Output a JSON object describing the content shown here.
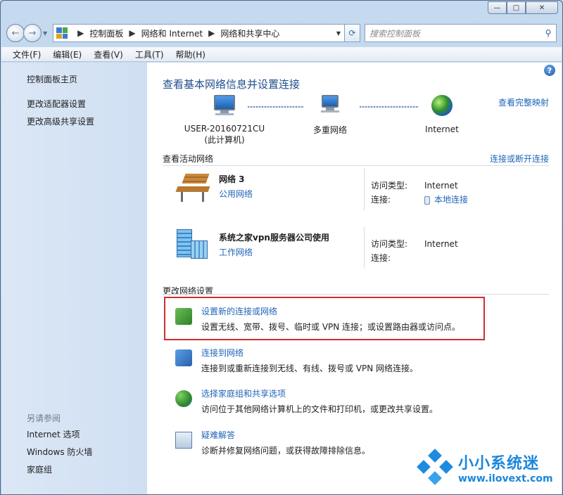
{
  "window": {
    "minimize": "—",
    "maximize": "□",
    "close": "✕"
  },
  "nav": {
    "back": "←",
    "forward": "→",
    "breadcrumbs": [
      "控制面板",
      "网络和 Internet",
      "网络和共享中心"
    ],
    "search_placeholder": "搜索控制面板"
  },
  "menu": [
    "文件(F)",
    "编辑(E)",
    "查看(V)",
    "工具(T)",
    "帮助(H)"
  ],
  "sidebar": {
    "home": "控制面板主页",
    "links": [
      "更改适配器设置",
      "更改高级共享设置"
    ],
    "see_also_title": "另请参阅",
    "see_also": [
      "Internet 选项",
      "Windows 防火墙",
      "家庭组"
    ]
  },
  "main": {
    "help": "?",
    "title": "查看基本网络信息并设置连接",
    "full_map_link": "查看完整映射",
    "map": {
      "computer": "USER-20160721CU",
      "computer_sub": "(此计算机)",
      "middle": "多重网络",
      "internet": "Internet"
    },
    "active_title": "查看活动网络",
    "connect_disconnect": "连接或断开连接",
    "networks": [
      {
        "name": "网络  3",
        "type": "公用网络",
        "access_label": "访问类型:",
        "access": "Internet",
        "conn_label": "连接:",
        "conn": "本地连接"
      },
      {
        "name": "系统之家vpn服务器公司使用",
        "type": "工作网络",
        "access_label": "访问类型:",
        "access": "Internet",
        "conn_label": "连接:",
        "conn": ""
      }
    ],
    "change_title": "更改网络设置",
    "tasks": [
      {
        "title": "设置新的连接或网络",
        "desc": "设置无线、宽带、拨号、临时或 VPN 连接；或设置路由器或访问点。"
      },
      {
        "title": "连接到网络",
        "desc": "连接到或重新连接到无线、有线、拨号或 VPN 网络连接。"
      },
      {
        "title": "选择家庭组和共享选项",
        "desc": "访问位于其他网络计算机上的文件和打印机，或更改共享设置。"
      },
      {
        "title": "疑难解答",
        "desc": "诊断并修复网络问题，或获得故障排除信息。"
      }
    ]
  },
  "watermark": {
    "title": "小小系统迷",
    "url": "www.ilovext.com"
  },
  "colors": {
    "link": "#1f64b8",
    "title": "#1f4e8c",
    "highlight": "#d22c2c",
    "sidebar": "#d6e4f5"
  }
}
